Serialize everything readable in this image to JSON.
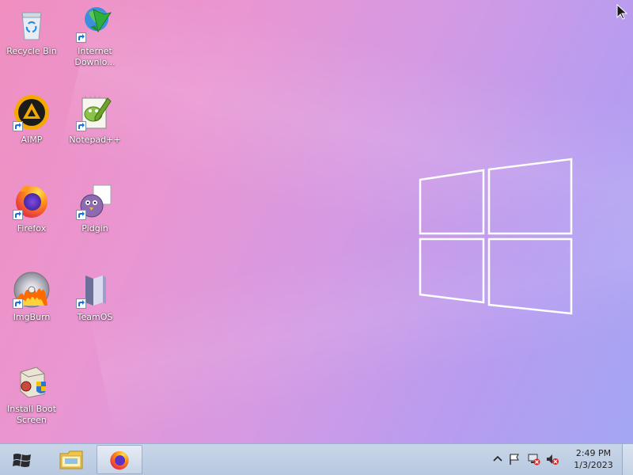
{
  "desktop": {
    "icons": [
      {
        "label": "Recycle Bin",
        "icon": "recycle-bin-icon"
      },
      {
        "label": "Internet\nDownlo...",
        "icon": "internet-download-manager-icon"
      },
      {
        "label": "AIMP",
        "icon": "aimp-icon"
      },
      {
        "label": "Notepad++",
        "icon": "notepad-plus-plus-icon"
      },
      {
        "label": "Firefox",
        "icon": "firefox-icon"
      },
      {
        "label": "Pidgin",
        "icon": "pidgin-icon"
      },
      {
        "label": "ImgBurn",
        "icon": "imgburn-icon"
      },
      {
        "label": "TeamOS",
        "icon": "teamos-icon"
      },
      {
        "label": "Install Boot\nScreen",
        "icon": "install-boot-screen-icon"
      }
    ]
  },
  "taskbar": {
    "start": {
      "icon": "windows-start-icon"
    },
    "pinned": [
      {
        "icon": "file-explorer-icon"
      },
      {
        "icon": "firefox-icon",
        "active": true
      }
    ],
    "tray": {
      "icons": [
        "show-hidden-icons-chevron-icon",
        "action-center-flag-icon",
        "network-disconnected-icon",
        "volume-muted-icon"
      ],
      "time": "2:49 PM",
      "date": "1/3/2023"
    }
  },
  "colors": {
    "desktop_gradient_start": "#f08fc0",
    "desktop_gradient_end": "#a3a6f4",
    "taskbar": "#c3d2e6"
  }
}
